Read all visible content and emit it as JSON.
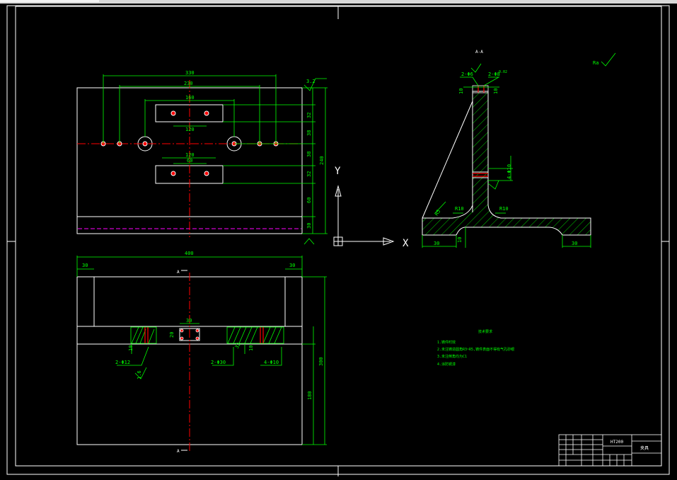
{
  "colors": {
    "background": "#000000",
    "outline": "#ffffff",
    "dimension": "#00ff00",
    "centerline": "#ff0000",
    "hidden": "#ff00ff",
    "hole_fill": "#ff0000"
  },
  "front_view": {
    "dims": {
      "top_outer": "330",
      "top_inner": "230",
      "slot_top": "160",
      "slot_top_inner": "120",
      "slot_bottom": "120",
      "slot_bottom_inner": "60",
      "right_32a": "32",
      "right_38a": "38",
      "right_38b": "38",
      "right_32b": "32",
      "right_60": "60",
      "right_30": "30",
      "total_height": "240",
      "roughness": "3.2"
    }
  },
  "bottom_view": {
    "dims": {
      "width": "400",
      "left_30": "30",
      "right_30": "30",
      "center_30": "30",
      "hole_2": "2-Φ12",
      "hole_30": "2-Φ30",
      "hole_10": "4-Φ10",
      "left_10": "10",
      "depth_10": "10",
      "height_300": "300",
      "height_180": "180",
      "mid_32": "32",
      "small_16": "1.6",
      "depth_20": "20"
    },
    "section_mark": "A"
  },
  "section_view": {
    "title": "A-A",
    "dims": {
      "hole_a": "2-Φ6",
      "hole_b": "2-Φ8",
      "top_val": "0.02",
      "hole_c": "4-Φ10",
      "r10a": "R10",
      "r10b": "R10",
      "r5": "R5",
      "bottom_left": "30",
      "bottom_mid": "10",
      "bottom_right": "30",
      "left_10": "10",
      "right_10": "10"
    },
    "roughness_label": "Ra"
  },
  "axes": {
    "x": "X",
    "y": "Y"
  },
  "notes": {
    "title": "技术要求",
    "lines": [
      "1.铸件时效",
      "2.未注铸造圆角R3~R5,铸件表面不得有气孔砂眼",
      "3.未注倒角均为C1",
      "4.涂防锈漆"
    ]
  },
  "title_block": {
    "material": "HT200",
    "name": "夹具"
  }
}
